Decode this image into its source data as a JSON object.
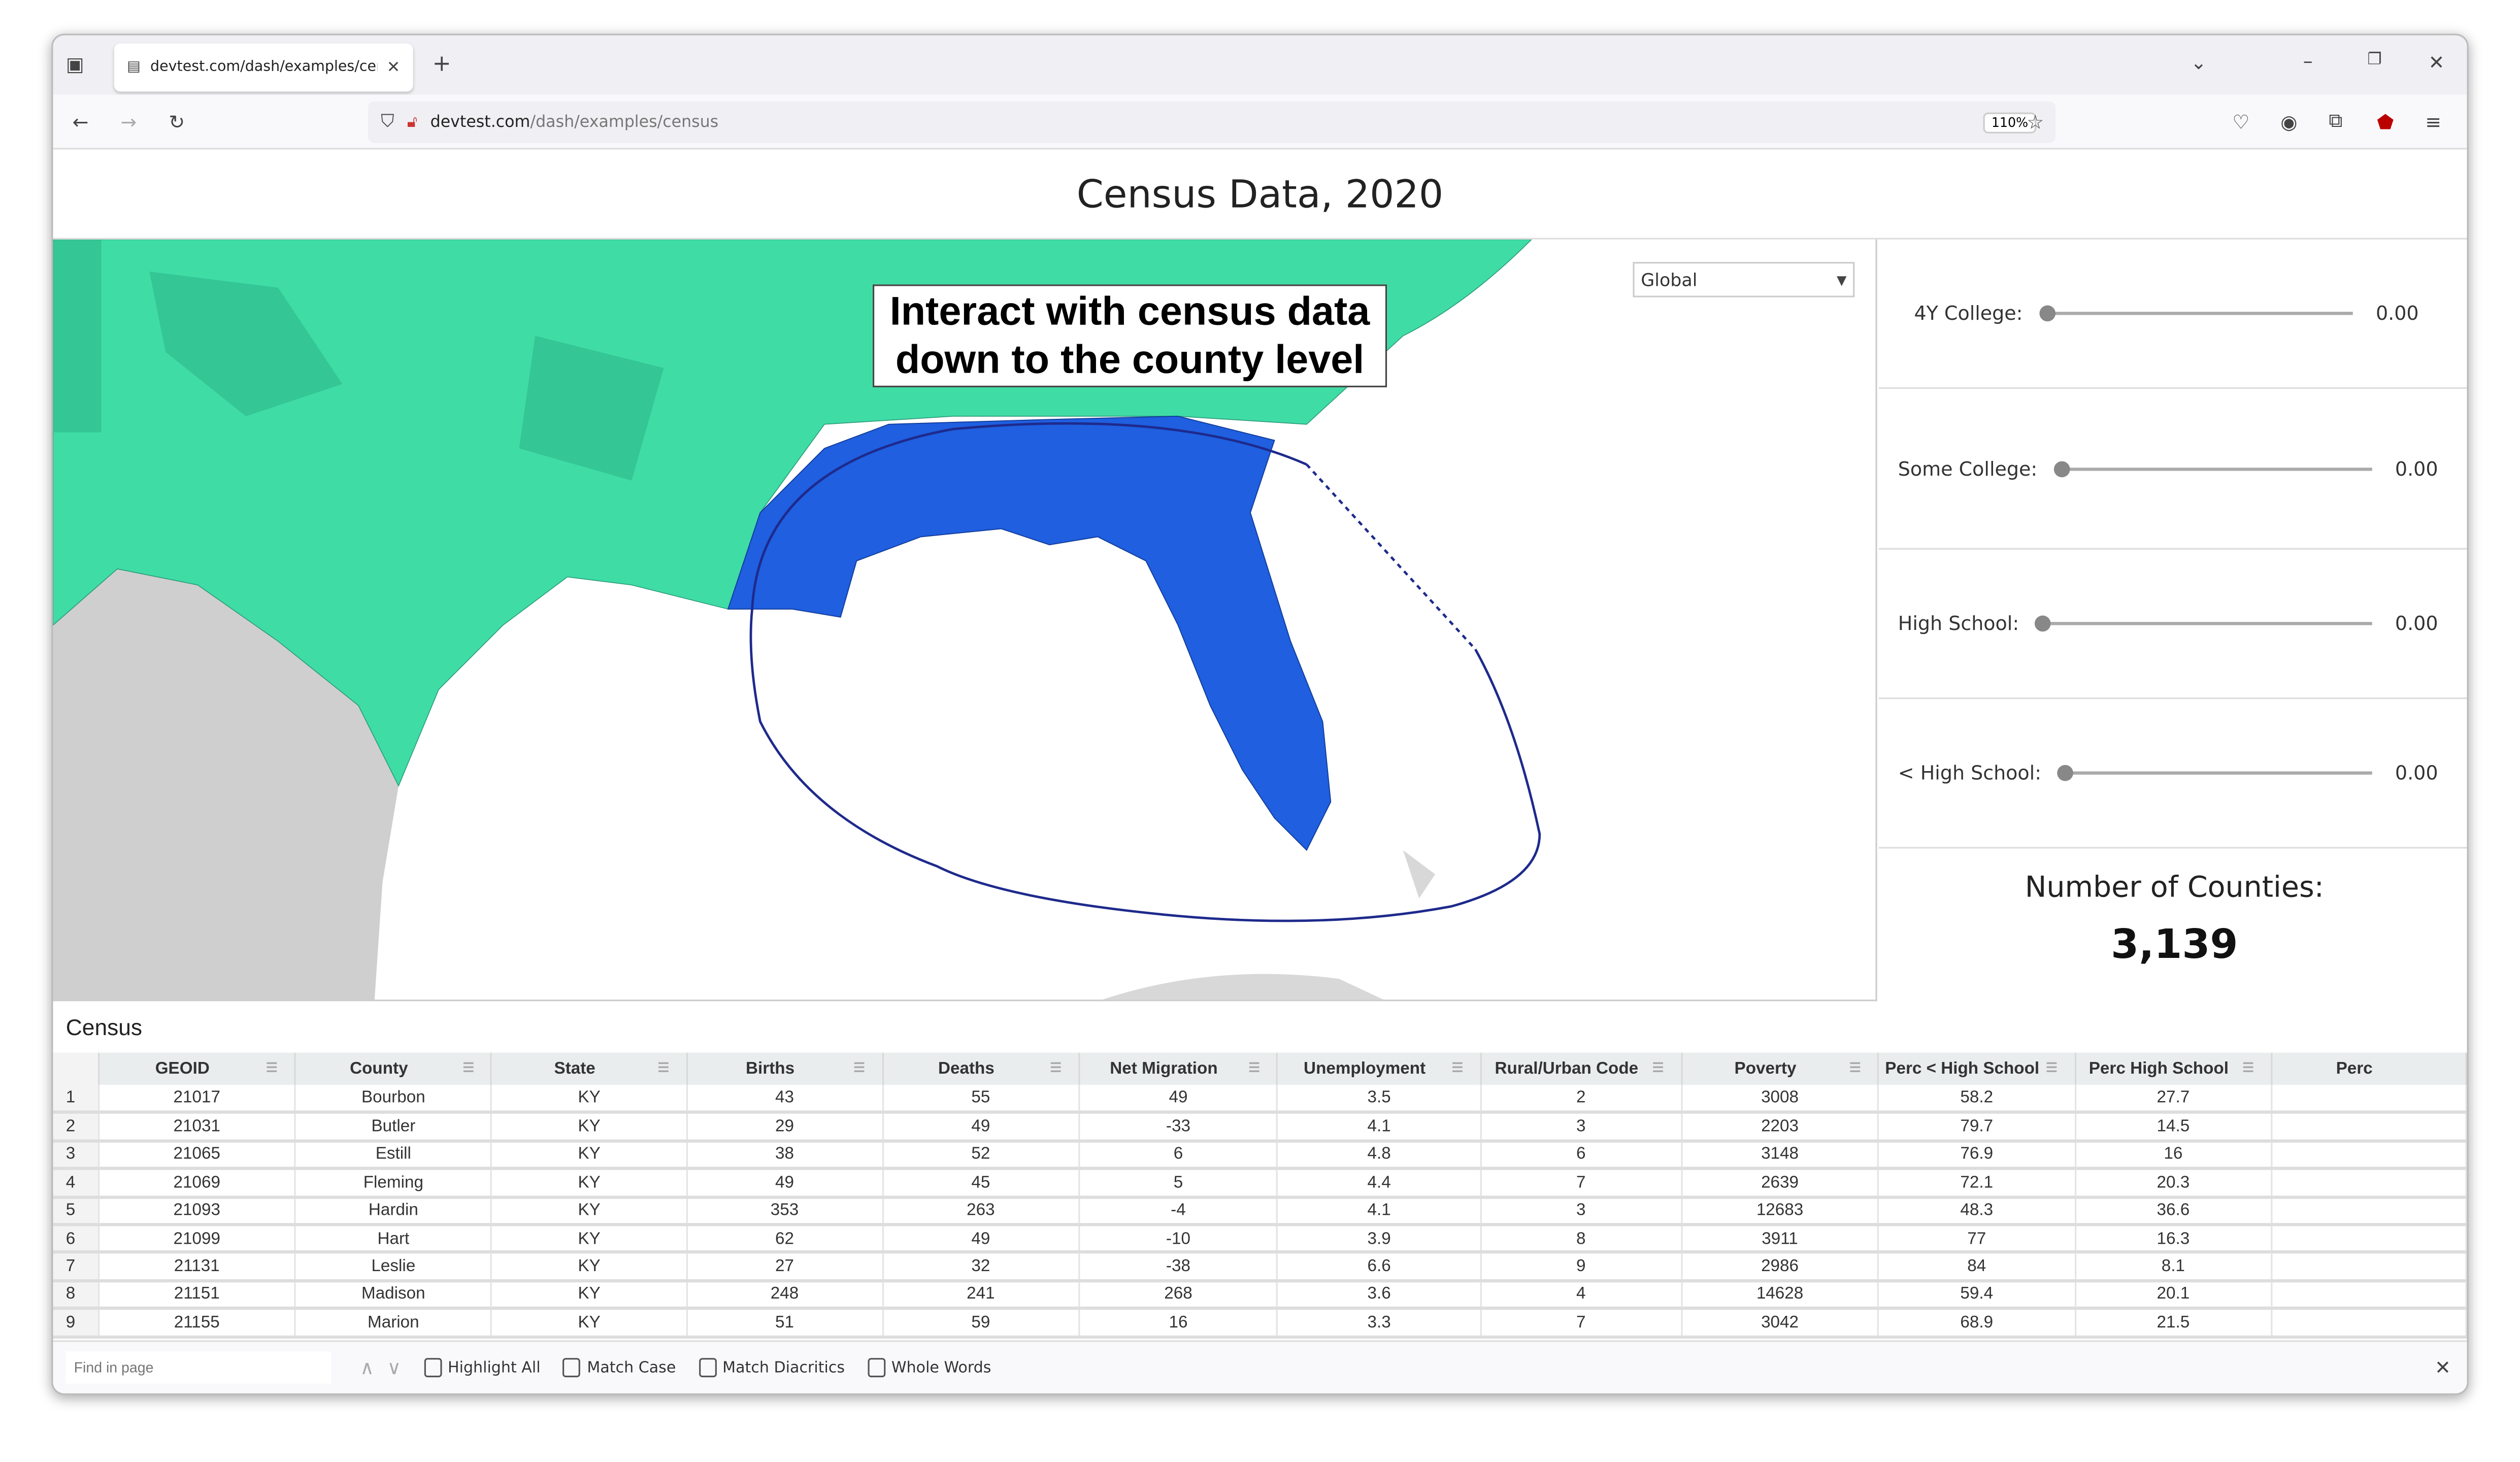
{
  "browser": {
    "tab_title": "devtest.com/dash/examples/census",
    "url_host": "devtest.com",
    "url_path": "/dash/examples/census",
    "zoom": "110%"
  },
  "page": {
    "title": "Census Data, 2020"
  },
  "map": {
    "dropdown_value": "Global",
    "annotation": "Interact with census data down to the county level",
    "colors": {
      "counties": "#3fdca6",
      "selected": "#1f5fe0",
      "lasso": "#1e2a8c",
      "land_other": "#cfcfcf"
    }
  },
  "sliders": [
    {
      "label": "4Y College:",
      "value": "0.00",
      "level": 0
    },
    {
      "label": "Some College:",
      "value": "0.00",
      "level": 0
    },
    {
      "label": "High School:",
      "value": "0.00",
      "level": 0
    },
    {
      "label": "< High School:",
      "value": "0.00",
      "level": 0
    }
  ],
  "counties": {
    "label": "Number of Counties:",
    "value": "3,139"
  },
  "table": {
    "title": "Census",
    "columns": [
      "GEOID",
      "County",
      "State",
      "Births",
      "Deaths",
      "Net Migration",
      "Unemployment",
      "Rural/Urban Code",
      "Poverty",
      "Perc < High School",
      "Perc High School",
      "Perc"
    ],
    "rows": [
      [
        "1",
        "21017",
        "Bourbon",
        "KY",
        "43",
        "55",
        "49",
        "3.5",
        "2",
        "3008",
        "58.2",
        "27.7",
        ""
      ],
      [
        "2",
        "21031",
        "Butler",
        "KY",
        "29",
        "49",
        "-33",
        "4.1",
        "3",
        "2203",
        "79.7",
        "14.5",
        ""
      ],
      [
        "3",
        "21065",
        "Estill",
        "KY",
        "38",
        "52",
        "6",
        "4.8",
        "6",
        "3148",
        "76.9",
        "16",
        ""
      ],
      [
        "4",
        "21069",
        "Fleming",
        "KY",
        "49",
        "45",
        "5",
        "4.4",
        "7",
        "2639",
        "72.1",
        "20.3",
        ""
      ],
      [
        "5",
        "21093",
        "Hardin",
        "KY",
        "353",
        "263",
        "-4",
        "4.1",
        "3",
        "12683",
        "48.3",
        "36.6",
        ""
      ],
      [
        "6",
        "21099",
        "Hart",
        "KY",
        "62",
        "49",
        "-10",
        "3.9",
        "8",
        "3911",
        "77",
        "16.3",
        ""
      ],
      [
        "7",
        "21131",
        "Leslie",
        "KY",
        "27",
        "32",
        "-38",
        "6.6",
        "9",
        "2986",
        "84",
        "8.1",
        ""
      ],
      [
        "8",
        "21151",
        "Madison",
        "KY",
        "248",
        "241",
        "268",
        "3.6",
        "4",
        "14628",
        "59.4",
        "20.1",
        ""
      ],
      [
        "9",
        "21155",
        "Marion",
        "KY",
        "51",
        "59",
        "16",
        "3.3",
        "7",
        "3042",
        "68.9",
        "21.5",
        ""
      ]
    ]
  },
  "findbar": {
    "placeholder": "Find in page",
    "options": [
      "Highlight All",
      "Match Case",
      "Match Diacritics",
      "Whole Words"
    ]
  }
}
